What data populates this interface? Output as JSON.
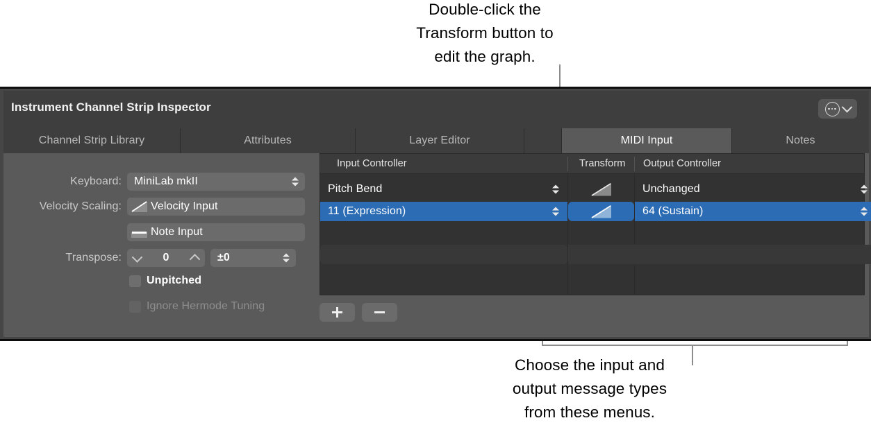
{
  "callouts": {
    "top": "Double-click the\nTransform button to\nedit the graph.",
    "bottom": "Choose the input and\noutput message types\nfrom these menus."
  },
  "window": {
    "title": "Instrument Channel Strip Inspector",
    "more_options_icon": "ellipsis-circle-icon",
    "more_options_chevron": "chevron-down-icon"
  },
  "tabs": [
    {
      "label": "Channel Strip Library",
      "selected": false
    },
    {
      "label": "Attributes",
      "selected": false
    },
    {
      "label": "Layer Editor",
      "selected": false
    },
    {
      "label": "",
      "selected": false
    },
    {
      "label": "MIDI Input",
      "selected": true
    },
    {
      "label": "Notes",
      "selected": false
    }
  ],
  "left_panel": {
    "keyboard": {
      "label": "Keyboard:",
      "value": "MiniLab mkII"
    },
    "velocity_scaling": {
      "label": "Velocity Scaling:",
      "value": "Velocity Input",
      "icon": "ramp-graph-icon"
    },
    "note_input": {
      "value": "Note Input",
      "icon": "flat-graph-icon"
    },
    "transpose": {
      "label": "Transpose:",
      "value": "0",
      "fine_value": "±0",
      "decrement_icon": "chevron-down-icon",
      "increment_icon": "chevron-up-icon"
    },
    "unpitched": {
      "label": "Unpitched",
      "checked": false,
      "enabled": true
    },
    "ignore_hermode_tuning": {
      "label": "Ignore Hermode Tuning",
      "checked": false,
      "enabled": false
    }
  },
  "table": {
    "columns": [
      "Input Controller",
      "Transform",
      "Output Controller"
    ],
    "rows": [
      {
        "input_controller": "Pitch Bend",
        "transform": "ramp-graph-icon",
        "output_controller": "Unchanged",
        "selected": false
      },
      {
        "input_controller": "11 (Expression)",
        "transform": "ramp-graph-icon",
        "output_controller": "64 (Sustain)",
        "selected": true
      }
    ],
    "add_button": "+",
    "remove_button": "−"
  },
  "colors": {
    "selection_blue": "#2b6cb4",
    "panel_gray": "#5a5a5a",
    "table_dark": "#323232",
    "titlebar": "#3e3e3e",
    "leader_line": "#8c8c8c"
  }
}
